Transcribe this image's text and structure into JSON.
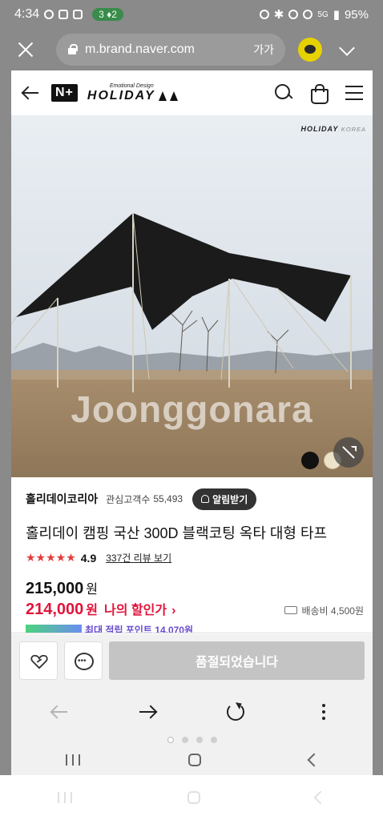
{
  "status": {
    "time": "4:34",
    "pill": "3 ♦2",
    "network": "5G",
    "battery": "95%"
  },
  "browser": {
    "url": "m.brand.naver.com",
    "text_size_label": "가가"
  },
  "site": {
    "nplus": "N+",
    "brand_tagline": "Emotional Design",
    "brand_name": "HOLIDAY"
  },
  "hero": {
    "logo_text": "HOLIDAY",
    "logo_suffix": "KOREA",
    "watermark": "Joonggonara",
    "color_options": [
      "#111111",
      "#ece3c8"
    ]
  },
  "store": {
    "name": "홀리데이코리아",
    "follow_label": "관심고객수",
    "follow_count": "55,493",
    "notify_label": "알림받기"
  },
  "product": {
    "title": "홀리데이 캠핑 국산 300D 블랙코팅 옥타 대형 타프",
    "stars": "★★★★★",
    "rating": "4.9",
    "review_link": "337건 리뷰 보기",
    "price_original": "215,000",
    "price_sale": "214,000",
    "currency": "원",
    "my_discount": "나의 할인가",
    "shipping": "배송비 4,500원",
    "point_text": "최대 적립 포인트 14,070원"
  },
  "actions": {
    "soldout_label": "품절되었습니다"
  },
  "colors": {
    "sale_red": "#e0143c",
    "star_red": "#e33c3c",
    "kakao_yellow": "#e6d200"
  }
}
